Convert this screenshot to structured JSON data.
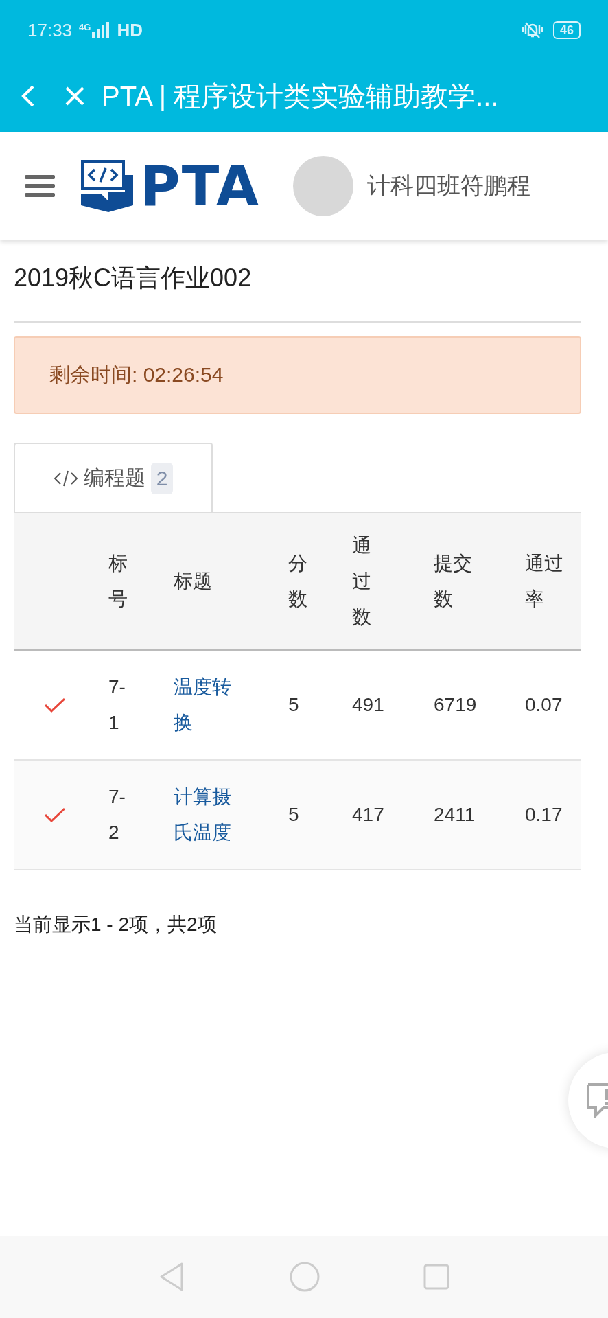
{
  "status_bar": {
    "time": "17:33",
    "network": "4G",
    "network_extra": "HD",
    "battery": "46"
  },
  "title_bar": {
    "title": "PTA | 程序设计类实验辅助教学..."
  },
  "header": {
    "logo_text": "PTA",
    "user_name": "计科四班符鹏程"
  },
  "page_title": "2019秋C语言作业002",
  "alert": {
    "text": "剩余时间: 02:26:54"
  },
  "tabs": [
    {
      "label": "编程题",
      "count": "2",
      "selected": true
    }
  ],
  "table": {
    "columns": [
      "标号",
      "标题",
      "分数",
      "通过数",
      "提交数",
      "通过率"
    ],
    "rows": [
      {
        "solved": true,
        "number": "7-1",
        "title": "温度转换",
        "score": "5",
        "passed": "491",
        "submitted": "6719",
        "pass_rate": "0.07"
      },
      {
        "solved": true,
        "number": "7-2",
        "title": "计算摄氏温度",
        "score": "5",
        "passed": "417",
        "submitted": "2411",
        "pass_rate": "0.17"
      }
    ]
  },
  "footer": "当前显示1 - 2项，共2项"
}
